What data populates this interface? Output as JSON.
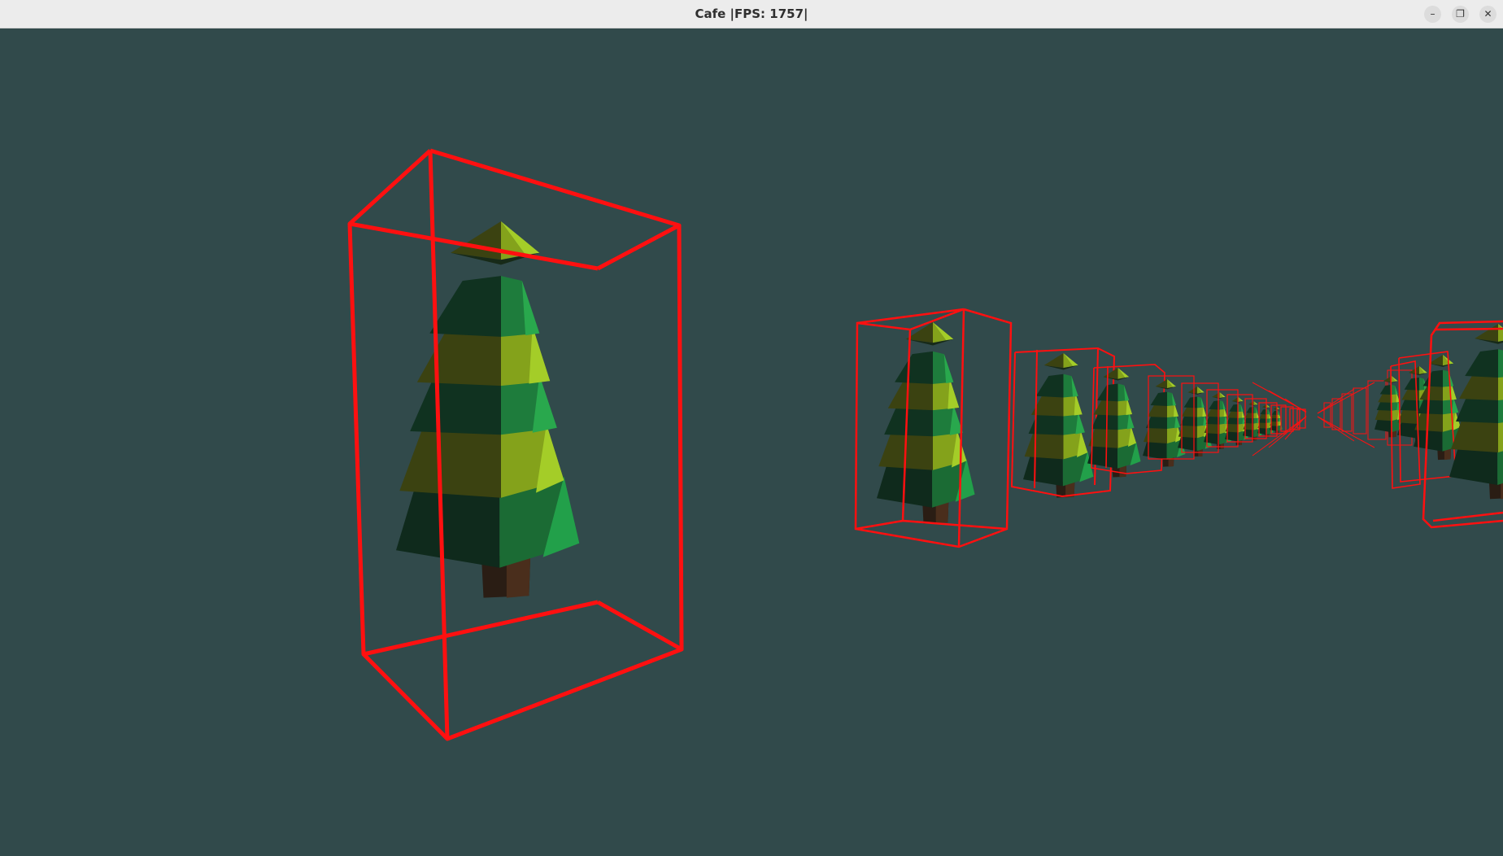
{
  "window": {
    "title": "Cafe |FPS: 1757|",
    "controls": [
      {
        "name": "minimize-button",
        "icon": "minimize-icon",
        "glyph": "–"
      },
      {
        "name": "restore-button",
        "icon": "restore-icon",
        "glyph": "❐"
      },
      {
        "name": "close-button",
        "icon": "close-icon",
        "glyph": "✕"
      }
    ]
  },
  "scene": {
    "background_color": "#314a4b",
    "bounding_box_color": "#ff1010",
    "objects": "row of low-poly pine trees with red wireframe bounding boxes"
  }
}
